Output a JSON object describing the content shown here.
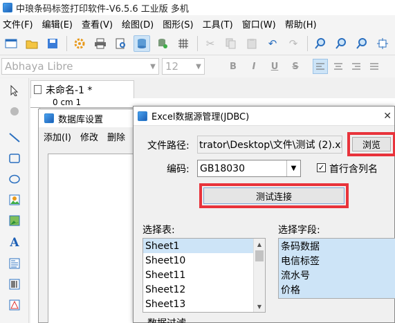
{
  "app": {
    "title": "中琅条码标签打印软件-V6.5.6 工业版 多机"
  },
  "menu": [
    "文件(F)",
    "编辑(E)",
    "查看(V)",
    "绘图(D)",
    "图形(S)",
    "工具(T)",
    "窗口(W)",
    "帮助(H)"
  ],
  "font_toolbar": {
    "font_name": "Abhaya Libre",
    "font_size": "12",
    "bold": "B",
    "italic": "I",
    "underline": "U",
    "strike": "S"
  },
  "document": {
    "tab_title": "未命名-1 *",
    "ruler_label": "0 cm 1"
  },
  "db_dialog": {
    "title": "数据库设置",
    "menu": [
      "添加(I)",
      "修改",
      "删除"
    ]
  },
  "excel_dialog": {
    "title": "Excel数据源管理(JDBC)",
    "path_label": "文件路径:",
    "path_value": "trator\\Desktop\\文件\\测试 (2).xls",
    "browse_label": "浏览",
    "encoding_label": "编码:",
    "encoding_value": "GB18030",
    "first_row_label": "首行含列名",
    "first_row_checked": true,
    "test_button_label": "测试连接",
    "tables_label": "选择表:",
    "fields_label": "选择字段:",
    "tables": [
      "Sheet1",
      "Sheet10",
      "Sheet11",
      "Sheet12",
      "Sheet13"
    ],
    "selected_table": "Sheet1",
    "fields": [
      "条码数据",
      "电信标签",
      "流水号",
      "价格"
    ],
    "filter_label": "数据过滤"
  },
  "colors": {
    "highlight_box": "#e8333b",
    "selection": "#cde4f7"
  }
}
